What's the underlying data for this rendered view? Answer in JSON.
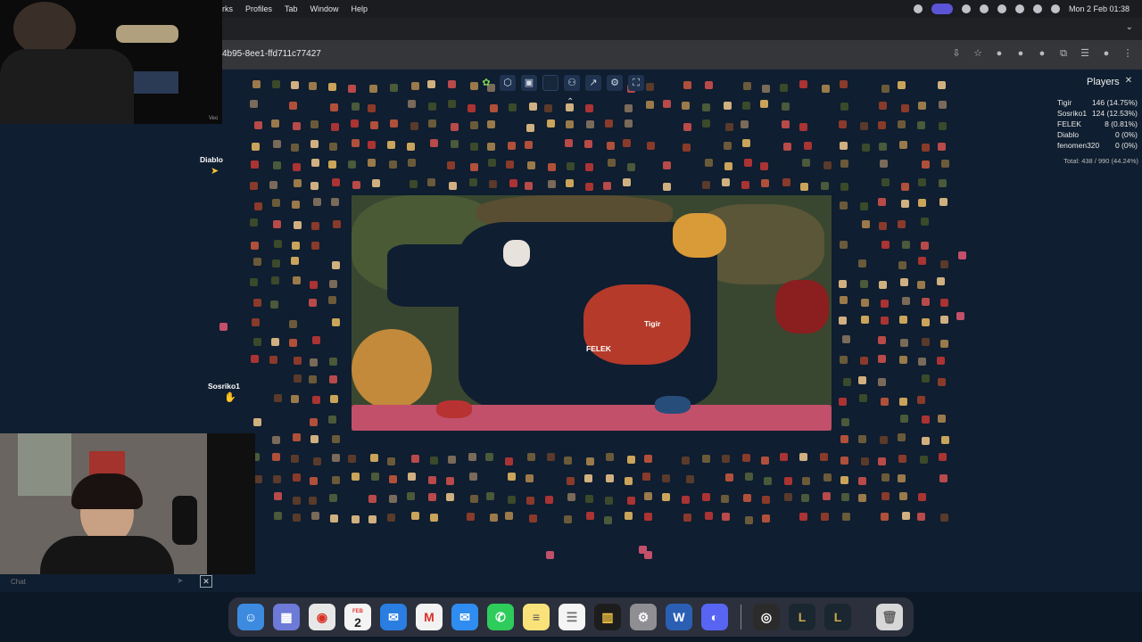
{
  "menubar": {
    "items": [
      "rks",
      "Profiles",
      "Tab",
      "Window",
      "Help"
    ],
    "datetime": "Mon 2 Feb  01:38"
  },
  "browser": {
    "url": "4b95-8ee1-ffd711c77427"
  },
  "players": {
    "title": "Players",
    "rows": [
      {
        "name": "Tigir",
        "stat": "146 (14.75%)"
      },
      {
        "name": "Sosriko1",
        "stat": "124 (12.53%)"
      },
      {
        "name": "FELEK",
        "stat": "8 (0.81%)"
      },
      {
        "name": "Diablo",
        "stat": "0 (0%)"
      },
      {
        "name": "fenomen320",
        "stat": "0 (0%)"
      }
    ],
    "total": "Total: 438 / 990 (44.24%)"
  },
  "cursors": {
    "diablo": "Diablo",
    "sosriko": "Sosriko1",
    "tigir": "Tigir",
    "felek": "FELEK"
  },
  "webcam": {
    "top_watermark": "Veo"
  },
  "chat": {
    "placeholder": "Chat"
  },
  "dock": {
    "calendar_month": "FEB",
    "calendar_day": "2"
  }
}
